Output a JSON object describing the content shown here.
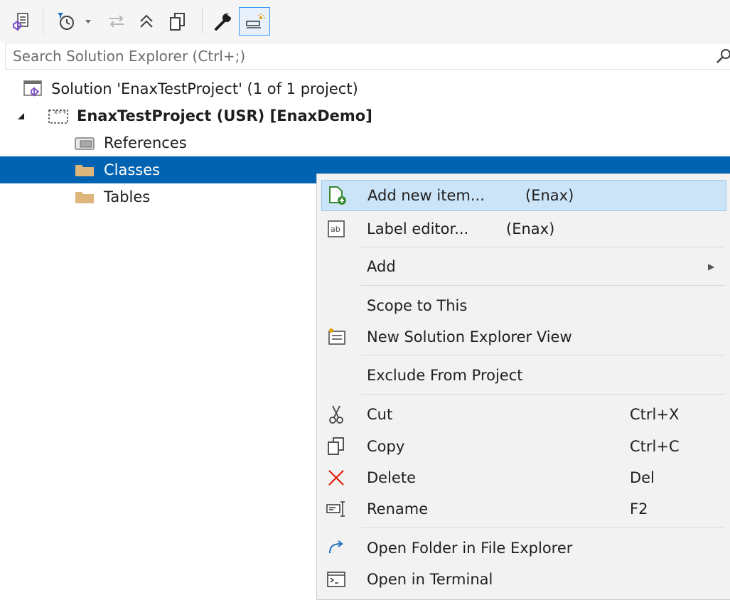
{
  "toolbar": {
    "buttons": [
      {
        "name": "vs-solution-icon"
      },
      {
        "name": "pending-changes-icon"
      },
      {
        "name": "dropdown-arrow-icon"
      },
      {
        "name": "sync-icon"
      },
      {
        "name": "collapse-all-icon"
      },
      {
        "name": "show-all-files-icon"
      },
      {
        "name": "properties-wrench-icon"
      },
      {
        "name": "preview-selected-icon"
      }
    ]
  },
  "search": {
    "placeholder": "Search Solution Explorer (Ctrl+;)",
    "value": ""
  },
  "tree": {
    "solution": "Solution 'EnaxTestProject' (1 of 1 project)",
    "project": "EnaxTestProject (USR) [EnaxDemo]",
    "references": "References",
    "classes": "Classes",
    "tables": "Tables"
  },
  "context_menu": {
    "add_new_item": {
      "label": "Add new item...",
      "extra": "(Enax)"
    },
    "label_editor": {
      "label": "Label editor...",
      "extra": "(Enax)"
    },
    "add": {
      "label": "Add"
    },
    "scope_to_this": {
      "label": "Scope to This"
    },
    "new_view": {
      "label": "New Solution Explorer View"
    },
    "exclude": {
      "label": "Exclude From Project"
    },
    "cut": {
      "label": "Cut",
      "shortcut": "Ctrl+X"
    },
    "copy": {
      "label": "Copy",
      "shortcut": "Ctrl+C"
    },
    "delete": {
      "label": "Delete",
      "shortcut": "Del"
    },
    "rename": {
      "label": "Rename",
      "shortcut": "F2"
    },
    "open_folder": {
      "label": "Open Folder in File Explorer"
    },
    "open_terminal": {
      "label": "Open in Terminal"
    }
  },
  "colors": {
    "selection": "#0063b1",
    "menu_highlight": "#cce4f7",
    "folder": "#dcb67a",
    "accent_purple": "#7b4ec5",
    "delete_red": "#e51400"
  }
}
